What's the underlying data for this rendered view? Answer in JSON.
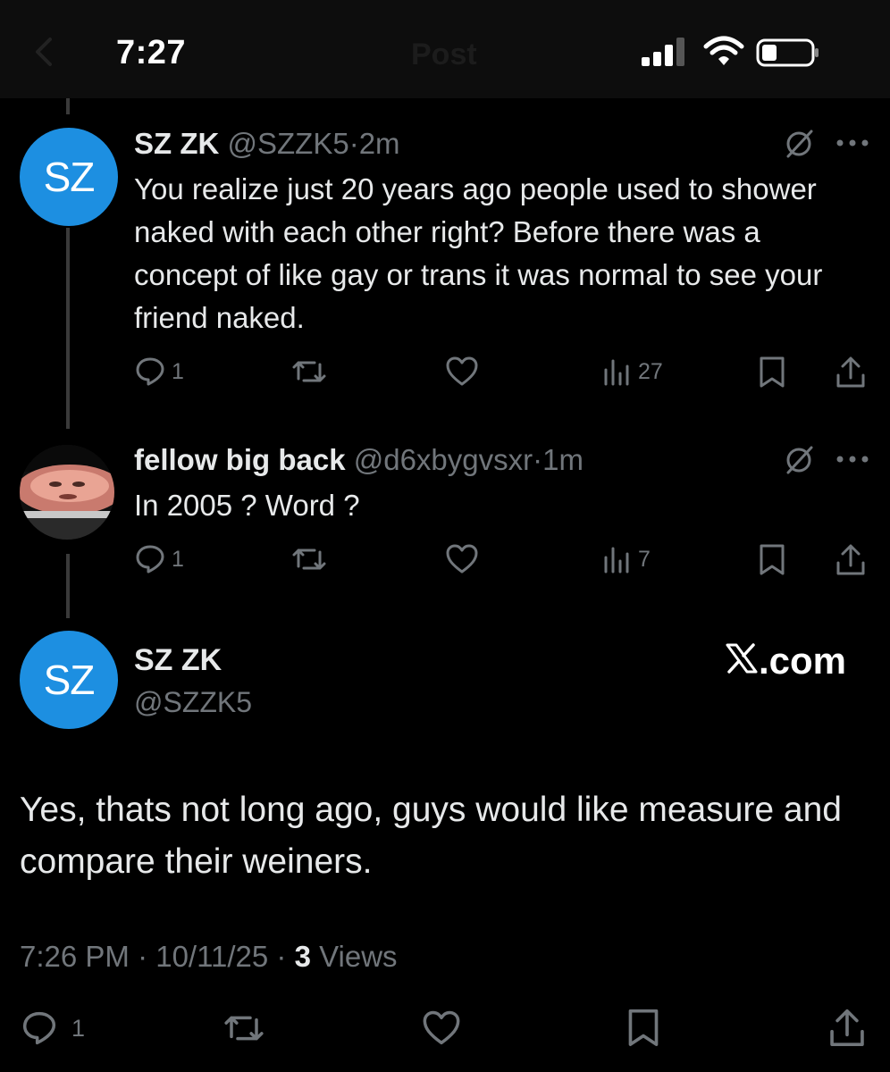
{
  "status_bar": {
    "time": "7:27",
    "header_title": "Post",
    "icons": [
      "back-arrow-icon",
      "signal-icon",
      "wifi-icon",
      "battery-icon"
    ]
  },
  "thread": [
    {
      "avatar_text": "SZ",
      "name": "SZ ZK",
      "handle": "@SZZK5",
      "separator": "·",
      "time": "2m",
      "text": "You realize just 20 years ago people used to shower naked with each other right? Before there was a concept of like gay or trans it was normal to see your friend naked.",
      "replies": "1",
      "views": "27"
    },
    {
      "name": "fellow big back",
      "handle": "@d6xbygvsxr",
      "separator": "·",
      "time": "1m",
      "text": "In 2005 ? Word ?",
      "replies": "1",
      "views": "7"
    }
  ],
  "main_tweet": {
    "avatar_text": "SZ",
    "name": "SZ ZK",
    "handle": "@SZZK5",
    "watermark": ".com",
    "text": "Yes, thats not long ago, guys would like measure and compare their weiners.",
    "timestamp": "7:26 PM · 10/11/25 · ",
    "views_count": "3",
    "views_label": " Views",
    "replies": "1"
  },
  "colors": {
    "background": "#000000",
    "text_primary": "#e7e9ea",
    "text_secondary": "#71767b",
    "avatar_blue": "#1d8fe1",
    "thread_line": "#3a3a3a"
  }
}
